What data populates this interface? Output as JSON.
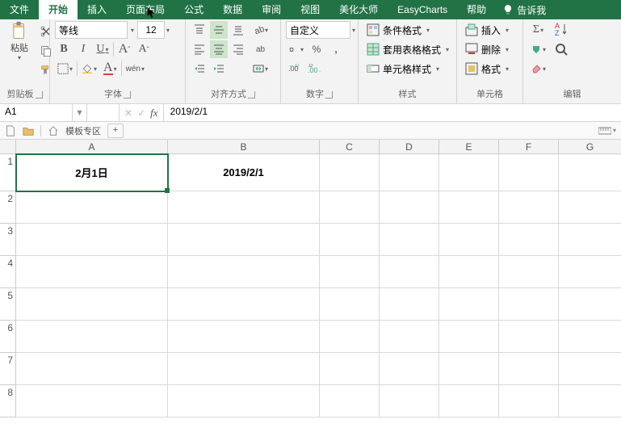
{
  "tabs": [
    "文件",
    "开始",
    "插入",
    "页面布局",
    "公式",
    "数据",
    "审阅",
    "视图",
    "美化大师",
    "EasyCharts",
    "帮助"
  ],
  "active_tab": "开始",
  "tell_me": "告诉我",
  "groups": {
    "clipboard": {
      "paste": "粘贴",
      "label": "剪贴板"
    },
    "font": {
      "name": "等线",
      "size": "12",
      "bold": "B",
      "italic": "I",
      "underline": "U",
      "grow": "A",
      "shrink": "A",
      "font_color": "A",
      "wen": "wén",
      "label": "字体"
    },
    "align": {
      "label": "对齐方式",
      "wrap": "ab"
    },
    "number": {
      "format": "自定义",
      "pct": "%",
      "comma": ",",
      "label": "数字"
    },
    "styles": {
      "cond": "条件格式",
      "table": "套用表格格式",
      "cell": "单元格样式",
      "label": "样式"
    },
    "cells": {
      "insert": "插入",
      "delete": "删除",
      "format": "格式",
      "label": "单元格"
    },
    "editing": {
      "sigma": "Σ",
      "label": "编辑"
    }
  },
  "namebox": "A1",
  "formula": "2019/2/1",
  "sheetrow": {
    "template": "模板专区"
  },
  "columns": [
    "A",
    "B",
    "C",
    "D",
    "E",
    "F",
    "G"
  ],
  "rows": [
    1,
    2,
    3,
    4,
    5,
    6,
    7,
    8
  ],
  "cellA1": "2月1日",
  "cellB1": "2019/2/1"
}
